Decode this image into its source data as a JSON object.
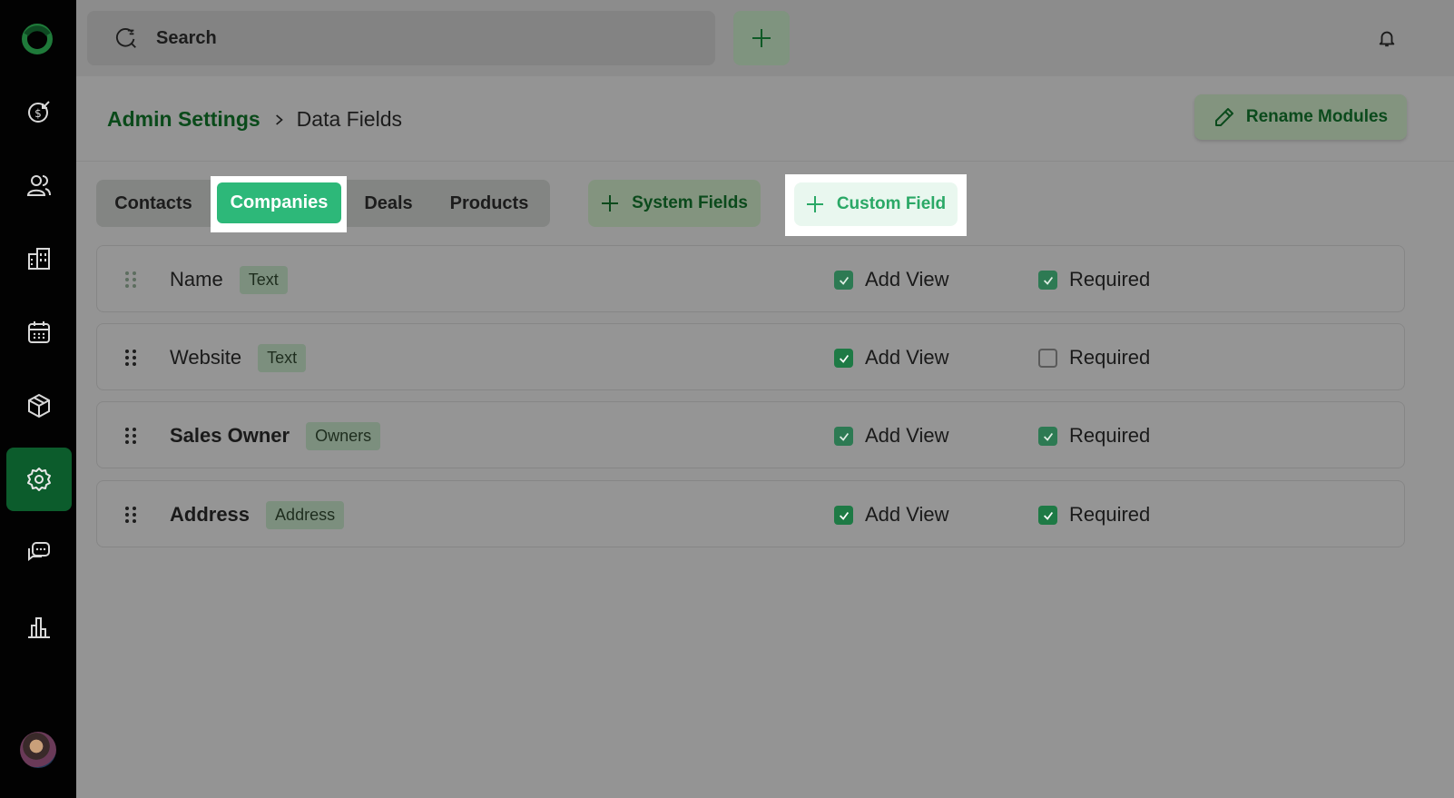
{
  "topbar": {
    "search_placeholder": "Search"
  },
  "breadcrumb": {
    "root": "Admin Settings",
    "current": "Data Fields"
  },
  "header": {
    "rename_label": "Rename Modules"
  },
  "tabs": [
    {
      "label": "Contacts"
    },
    {
      "label": "Companies"
    },
    {
      "label": "Deals"
    },
    {
      "label": "Products"
    }
  ],
  "active_tab": "Companies",
  "buttons": {
    "system_fields": "System Fields",
    "custom_field": "Custom Field"
  },
  "fields": [
    {
      "name": "Name",
      "type": "Text",
      "add_view_label": "Add View",
      "add_view": true,
      "required_label": "Required",
      "required": true
    },
    {
      "name": "Website",
      "type": "Text",
      "add_view_label": "Add View",
      "add_view": true,
      "required_label": "Required",
      "required": false
    },
    {
      "name": "Sales Owner",
      "type": "Owners",
      "add_view_label": "Add View",
      "add_view": true,
      "required_label": "Required",
      "required": true
    },
    {
      "name": "Address",
      "type": "Address",
      "add_view_label": "Add View",
      "add_view": true,
      "required_label": "Required",
      "required": true
    }
  ],
  "sidebar": {
    "items": [
      {
        "icon": "revenue-icon"
      },
      {
        "icon": "contacts-icon"
      },
      {
        "icon": "companies-icon"
      },
      {
        "icon": "calendar-icon"
      },
      {
        "icon": "products-icon"
      },
      {
        "icon": "settings-icon",
        "active": true
      },
      {
        "icon": "messages-icon"
      },
      {
        "icon": "reports-icon"
      }
    ]
  },
  "colors": {
    "accent": "#2db879",
    "brand_dark": "#0c5c2c",
    "sidebar_bg": "#020202"
  }
}
